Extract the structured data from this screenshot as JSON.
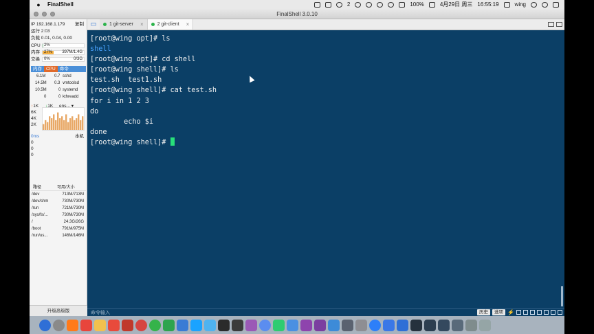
{
  "menubar": {
    "apple": "",
    "app_name": "FinalShell",
    "battery": "100%",
    "date": "4月29日 周三",
    "time": "16:55:19",
    "user": "wing",
    "notif_count": "2"
  },
  "window": {
    "title": "FinalShell 3.0.10"
  },
  "tabs": [
    {
      "label": "1 git-server",
      "active": false
    },
    {
      "label": "2 git-client",
      "active": true
    }
  ],
  "monitor": {
    "ip": "IP 192.168.1.179",
    "copy": "复制",
    "uptime": "运行 2:03",
    "load": "负载 0.01, 0.04, 0.00",
    "cpu_label": "CPU",
    "cpu_value": "2%",
    "cpu_percent": 2,
    "mem_label": "内存",
    "mem_percent_text": "27%",
    "mem_percent": 27,
    "mem_value": "397M/1.4G",
    "swap_label": "交换",
    "swap_percent_text": "0%",
    "swap_value": "0/3G",
    "proc_tabs": [
      "内存",
      "CPU",
      "命令"
    ],
    "processes": [
      {
        "mem": "6.1M",
        "cpu": "0.7",
        "cmd": "sshd"
      },
      {
        "mem": "14.5M",
        "cpu": "0.3",
        "cmd": "vmtoolsd"
      },
      {
        "mem": "10.5M",
        "cpu": "0",
        "cmd": "systemd"
      },
      {
        "mem": "0",
        "cpu": "0",
        "cmd": "kthreadd"
      }
    ],
    "net_up": "1K",
    "net_down": "1K",
    "net_iface": "ens...",
    "net_scale": [
      "6K",
      "4K",
      "2K"
    ],
    "net_graph_values": [
      0.3,
      0.5,
      0.4,
      0.7,
      0.6,
      0.8,
      0.5,
      0.9,
      0.6,
      0.7,
      0.5,
      0.8,
      0.4,
      0.6,
      0.7,
      0.5,
      0.6,
      0.8,
      0.5,
      0.7
    ],
    "ping_label": "0ms",
    "ping_host": "本机",
    "ping_values": [
      "0",
      "0",
      "0"
    ],
    "disk_head_path": "路径",
    "disk_head_size": "可用/大小",
    "disks": [
      {
        "path": "/dev",
        "size": "713M/713M"
      },
      {
        "path": "/dev/shm",
        "size": "730M/730M"
      },
      {
        "path": "/run",
        "size": "721M/730M"
      },
      {
        "path": "/sys/fs/...",
        "size": "730M/730M"
      },
      {
        "path": "/",
        "size": "24.3G/26G"
      },
      {
        "path": "/boot",
        "size": "791M/975M"
      },
      {
        "path": "/run/us...",
        "size": "146M/146M"
      }
    ],
    "upgrade": "升级高级版"
  },
  "terminal": {
    "lines": [
      {
        "text": "[root@wing opt]# ls",
        "color": "#f0f0f0"
      },
      {
        "text": "shell",
        "color": "#4aa3ff"
      },
      {
        "text": "[root@wing opt]# cd shell",
        "color": "#f0f0f0"
      },
      {
        "text": "[root@wing shell]# ls",
        "color": "#f0f0f0"
      },
      {
        "text": "test.sh  test1.sh",
        "color": "#f0f0f0"
      },
      {
        "text": "[root@wing shell]# cat test.sh",
        "color": "#f0f0f0"
      },
      {
        "text": "for i in 1 2 3",
        "color": "#f0f0f0"
      },
      {
        "text": "do",
        "color": "#f0f0f0"
      },
      {
        "text": "        echo $i",
        "color": "#f0f0f0"
      },
      {
        "text": "done",
        "color": "#f0f0f0"
      }
    ],
    "prompt": "[root@wing shell]# "
  },
  "cmdbar": {
    "placeholder": "命令输入",
    "history": "历史",
    "options": "选项"
  },
  "dock_colors": [
    "#2f6fd6",
    "#8a8a8a",
    "#ff7a1a",
    "#e8453c",
    "#f2c14e",
    "#e84a3c",
    "#c0392b",
    "#d64541",
    "#35b34a",
    "#2da44e",
    "#3a7bd5",
    "#1aa3ff",
    "#4fb3f0",
    "#2b2b2b",
    "#3b3b3b",
    "#9b59b6",
    "#5b8def",
    "#2ecc71",
    "#4a90e2",
    "#8e44ad",
    "#7b3fa0",
    "#3d8bd8",
    "#5a6270",
    "#8e8e93",
    "#2d7ff9",
    "#3b78e7",
    "#2f6fd6",
    "#25313d",
    "#2c3e50",
    "#34495e",
    "#596a7a",
    "#7f8c8d",
    "#95a5a6"
  ]
}
